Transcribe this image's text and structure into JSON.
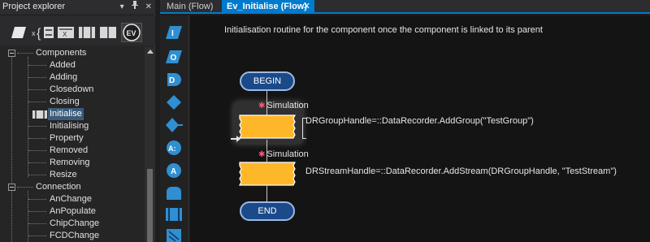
{
  "explorer": {
    "title": "Project explorer",
    "title_icons": [
      "dropdown-icon",
      "pin-icon",
      "close-icon"
    ],
    "toolbar_icons": [
      "parallelogram-icon",
      "variable-icon",
      "macro-icon",
      "component-icon",
      "component-alt-icon",
      "event-icon"
    ],
    "event_badge": "EV",
    "tree": [
      {
        "label": "Components",
        "level": 0,
        "expanded": true
      },
      {
        "label": "Added",
        "level": 1
      },
      {
        "label": "Adding",
        "level": 1
      },
      {
        "label": "Closedown",
        "level": 1
      },
      {
        "label": "Closing",
        "level": 1
      },
      {
        "label": "Initialise",
        "level": 1,
        "selected": true
      },
      {
        "label": "Initialising",
        "level": 1
      },
      {
        "label": "Property",
        "level": 1
      },
      {
        "label": "Removed",
        "level": 1
      },
      {
        "label": "Removing",
        "level": 1
      },
      {
        "label": "Resize",
        "level": 1
      },
      {
        "label": "Connection",
        "level": 0,
        "expanded": true
      },
      {
        "label": "AnChange",
        "level": 1
      },
      {
        "label": "AnPopulate",
        "level": 1
      },
      {
        "label": "ChipChange",
        "level": 1
      },
      {
        "label": "FCDChange",
        "level": 1
      }
    ]
  },
  "tabs": [
    {
      "label": "Main (Flow)",
      "active": false
    },
    {
      "label": "Ev_Initialise (Flow)",
      "active": true,
      "close": "✕"
    }
  ],
  "palette": {
    "icons": [
      "input-icon",
      "output-icon",
      "delay-icon",
      "decision-icon",
      "switch-icon",
      "calculation-icon",
      "component-macro-icon",
      "loop-icon",
      "macro-call-icon",
      "connection-point-icon"
    ],
    "letters": {
      "input": "I",
      "output": "O",
      "delay": "D",
      "calc": "A:",
      "comp": "A"
    }
  },
  "flowchart": {
    "description": "Initialisation routine for the component once the component is linked to its parent",
    "begin_label": "BEGIN",
    "end_label": "END",
    "commands": [
      {
        "annotation": "Simulation",
        "code": "DRGroupHandle=::DataRecorder.AddGroup(\"TestGroup\")",
        "highlighted": true
      },
      {
        "annotation": "Simulation",
        "code": "DRStreamHandle=::DataRecorder.AddStream(DRGroupHandle, \"TestStream\")",
        "highlighted": false
      }
    ],
    "colors": {
      "command_fill": "#ffb72a",
      "terminal_fill": "#1b4a8a",
      "tab_accent": "#007acc"
    }
  }
}
